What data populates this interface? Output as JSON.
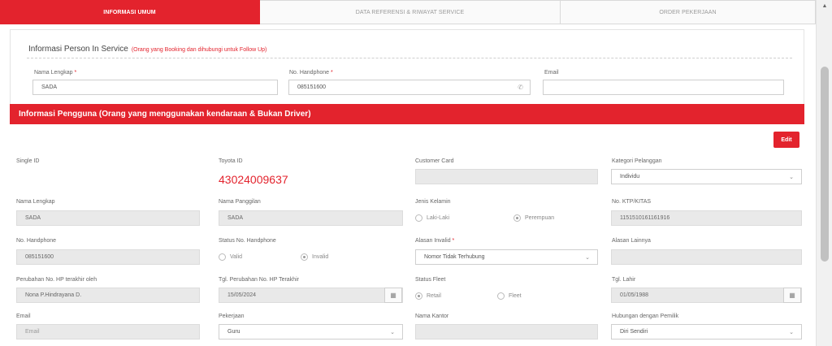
{
  "tabs": [
    "INFORMASI UMUM",
    "DATA REFERENSI & RIWAYAT SERVICE",
    "ORDER PEKERJAAN"
  ],
  "pis": {
    "title": "Informasi Person In Service",
    "subtitle": "(Orang yang Booking dan dihubungi untuk Follow Up)",
    "nama_label": "Nama Lengkap",
    "nama_value": "SADA",
    "hp_label": "No. Handphone",
    "hp_value": "085151600",
    "email_label": "Email",
    "email_value": ""
  },
  "icons": {
    "phone": "phone-icon",
    "calendar": "calendar-icon",
    "chevron": "chevron-down-icon",
    "scroll_up": "arrow-up-icon"
  },
  "colors": {
    "accent": "#e3232d"
  },
  "pengguna": {
    "title": "Informasi Pengguna (Orang yang menggunakan kendaraan & Bukan Driver)",
    "edit_label": "Edit",
    "single_id_label": "Single ID",
    "toyota_id_label": "Toyota ID",
    "toyota_id_value": "43024009637",
    "customer_card_label": "Customer Card",
    "customer_card_value": "",
    "kategori_label": "Kategori Pelanggan",
    "kategori_value": "Individu",
    "nama_label": "Nama Lengkap",
    "nama_value": "SADA",
    "panggilan_label": "Nama Panggilan",
    "panggilan_value": "SADA",
    "gender_label": "Jenis Kelamin",
    "gender_options": [
      "Laki-Laki",
      "Perempuan"
    ],
    "gender_selected": "Perempuan",
    "ktp_label": "No. KTP/KITAS",
    "ktp_value": "1151510161161916",
    "hp_label": "No. Handphone",
    "hp_value": "085151600",
    "status_hp_label": "Status No. Handphone",
    "status_hp_options": [
      "Valid",
      "Invalid"
    ],
    "status_hp_selected": "Invalid",
    "alasan_invalid_label": "Alasan Invalid",
    "alasan_invalid_value": "Nomor Tidak Terhubung",
    "alasan_lain_label": "Alasan Lainnya",
    "alasan_lain_value": "",
    "perubahan_oleh_label": "Perubahan No. HP terakhir oleh",
    "perubahan_oleh_value": "Nona P.Hindrayana D.",
    "tgl_perubahan_label": "Tgl. Perubahan No. HP Terakhir",
    "tgl_perubahan_value": "15/05/2024",
    "status_fleet_label": "Status Fleet",
    "status_fleet_options": [
      "Retail",
      "Fleet"
    ],
    "status_fleet_selected": "Retail",
    "tgl_lahir_label": "Tgl. Lahir",
    "tgl_lahir_value": "01/05/1988",
    "email_label": "Email",
    "email_placeholder": "Email",
    "pekerjaan_label": "Pekerjaan",
    "pekerjaan_value": "Guru",
    "kantor_label": "Nama Kantor",
    "kantor_value": "",
    "hubungan_label": "Hubungan dengan Pemilik",
    "hubungan_value": "Diri Sendiri"
  }
}
